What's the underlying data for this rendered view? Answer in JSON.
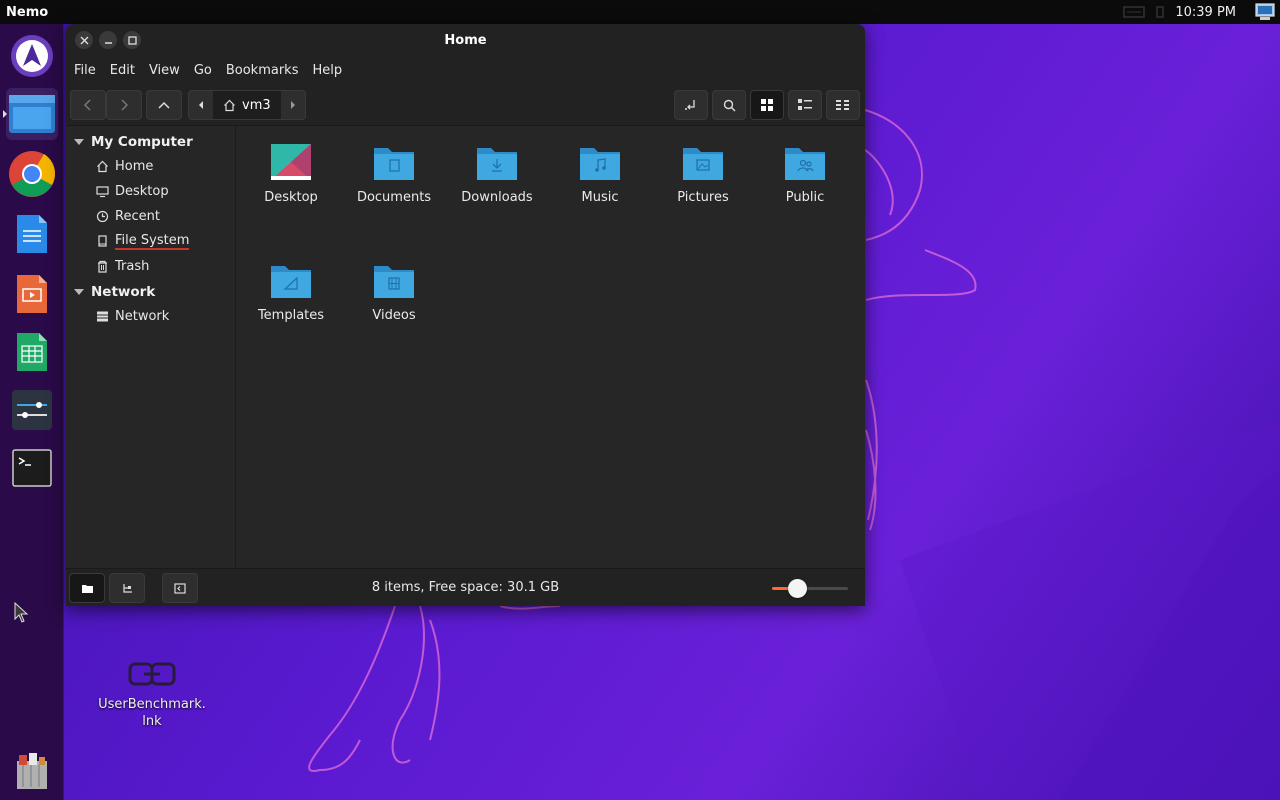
{
  "top_panel": {
    "app_name": "Nemo",
    "clock": "10:39 PM"
  },
  "dock": {
    "items": [
      {
        "name": "app-launcher",
        "icon": "launcher-icon"
      },
      {
        "name": "nemo-files",
        "icon": "folder-window-icon",
        "active": true
      },
      {
        "name": "chrome",
        "icon": "chrome-icon"
      },
      {
        "name": "writer",
        "icon": "document-icon"
      },
      {
        "name": "impress",
        "icon": "presentation-icon"
      },
      {
        "name": "calc",
        "icon": "spreadsheet-icon"
      },
      {
        "name": "settings",
        "icon": "sliders-icon"
      },
      {
        "name": "terminal",
        "icon": "terminal-icon"
      },
      {
        "name": "trash-app",
        "icon": "archive-icon"
      }
    ]
  },
  "window": {
    "title": "Home",
    "menu": [
      "File",
      "Edit",
      "View",
      "Go",
      "Bookmarks",
      "Help"
    ],
    "path": {
      "crumb": "vm3",
      "icon": "home-icon"
    },
    "sidebar": {
      "sections": [
        {
          "title": "My Computer",
          "items": [
            {
              "label": "Home",
              "icon": "home-icon"
            },
            {
              "label": "Desktop",
              "icon": "desktop-icon"
            },
            {
              "label": "Recent",
              "icon": "clock-icon"
            },
            {
              "label": "File System",
              "icon": "drive-icon"
            },
            {
              "label": "Trash",
              "icon": "trash-icon"
            }
          ]
        },
        {
          "title": "Network",
          "items": [
            {
              "label": "Network",
              "icon": "network-icon"
            }
          ]
        }
      ]
    },
    "files": [
      {
        "label": "Desktop",
        "icon": "desktop-folder-icon"
      },
      {
        "label": "Documents",
        "icon": "documents-folder-icon"
      },
      {
        "label": "Downloads",
        "icon": "downloads-folder-icon"
      },
      {
        "label": "Music",
        "icon": "music-folder-icon"
      },
      {
        "label": "Pictures",
        "icon": "pictures-folder-icon"
      },
      {
        "label": "Public",
        "icon": "public-folder-icon"
      },
      {
        "label": "Templates",
        "icon": "templates-folder-icon"
      },
      {
        "label": "Videos",
        "icon": "videos-folder-icon"
      }
    ],
    "status": "8 items, Free space: 30.1 GB",
    "zoom_level": 0.33
  },
  "desktop": {
    "icons": [
      {
        "label_line1": "UserBenchmark.",
        "label_line2": "lnk",
        "icon": "link-icon"
      }
    ]
  },
  "colors": {
    "accent": "#ff6b2c",
    "folder": "#3fa8e0",
    "window_bg": "#262626"
  }
}
